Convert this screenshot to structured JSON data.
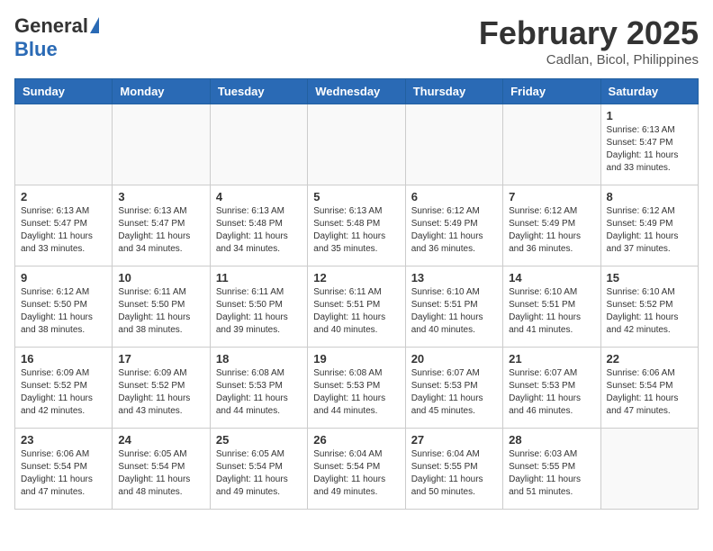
{
  "header": {
    "logo_general": "General",
    "logo_blue": "Blue",
    "month_title": "February 2025",
    "location": "Cadlan, Bicol, Philippines"
  },
  "weekdays": [
    "Sunday",
    "Monday",
    "Tuesday",
    "Wednesday",
    "Thursday",
    "Friday",
    "Saturday"
  ],
  "weeks": [
    [
      {
        "day": "",
        "info": ""
      },
      {
        "day": "",
        "info": ""
      },
      {
        "day": "",
        "info": ""
      },
      {
        "day": "",
        "info": ""
      },
      {
        "day": "",
        "info": ""
      },
      {
        "day": "",
        "info": ""
      },
      {
        "day": "1",
        "info": "Sunrise: 6:13 AM\nSunset: 5:47 PM\nDaylight: 11 hours\nand 33 minutes."
      }
    ],
    [
      {
        "day": "2",
        "info": "Sunrise: 6:13 AM\nSunset: 5:47 PM\nDaylight: 11 hours\nand 33 minutes."
      },
      {
        "day": "3",
        "info": "Sunrise: 6:13 AM\nSunset: 5:47 PM\nDaylight: 11 hours\nand 34 minutes."
      },
      {
        "day": "4",
        "info": "Sunrise: 6:13 AM\nSunset: 5:48 PM\nDaylight: 11 hours\nand 34 minutes."
      },
      {
        "day": "5",
        "info": "Sunrise: 6:13 AM\nSunset: 5:48 PM\nDaylight: 11 hours\nand 35 minutes."
      },
      {
        "day": "6",
        "info": "Sunrise: 6:12 AM\nSunset: 5:49 PM\nDaylight: 11 hours\nand 36 minutes."
      },
      {
        "day": "7",
        "info": "Sunrise: 6:12 AM\nSunset: 5:49 PM\nDaylight: 11 hours\nand 36 minutes."
      },
      {
        "day": "8",
        "info": "Sunrise: 6:12 AM\nSunset: 5:49 PM\nDaylight: 11 hours\nand 37 minutes."
      }
    ],
    [
      {
        "day": "9",
        "info": "Sunrise: 6:12 AM\nSunset: 5:50 PM\nDaylight: 11 hours\nand 38 minutes."
      },
      {
        "day": "10",
        "info": "Sunrise: 6:11 AM\nSunset: 5:50 PM\nDaylight: 11 hours\nand 38 minutes."
      },
      {
        "day": "11",
        "info": "Sunrise: 6:11 AM\nSunset: 5:50 PM\nDaylight: 11 hours\nand 39 minutes."
      },
      {
        "day": "12",
        "info": "Sunrise: 6:11 AM\nSunset: 5:51 PM\nDaylight: 11 hours\nand 40 minutes."
      },
      {
        "day": "13",
        "info": "Sunrise: 6:10 AM\nSunset: 5:51 PM\nDaylight: 11 hours\nand 40 minutes."
      },
      {
        "day": "14",
        "info": "Sunrise: 6:10 AM\nSunset: 5:51 PM\nDaylight: 11 hours\nand 41 minutes."
      },
      {
        "day": "15",
        "info": "Sunrise: 6:10 AM\nSunset: 5:52 PM\nDaylight: 11 hours\nand 42 minutes."
      }
    ],
    [
      {
        "day": "16",
        "info": "Sunrise: 6:09 AM\nSunset: 5:52 PM\nDaylight: 11 hours\nand 42 minutes."
      },
      {
        "day": "17",
        "info": "Sunrise: 6:09 AM\nSunset: 5:52 PM\nDaylight: 11 hours\nand 43 minutes."
      },
      {
        "day": "18",
        "info": "Sunrise: 6:08 AM\nSunset: 5:53 PM\nDaylight: 11 hours\nand 44 minutes."
      },
      {
        "day": "19",
        "info": "Sunrise: 6:08 AM\nSunset: 5:53 PM\nDaylight: 11 hours\nand 44 minutes."
      },
      {
        "day": "20",
        "info": "Sunrise: 6:07 AM\nSunset: 5:53 PM\nDaylight: 11 hours\nand 45 minutes."
      },
      {
        "day": "21",
        "info": "Sunrise: 6:07 AM\nSunset: 5:53 PM\nDaylight: 11 hours\nand 46 minutes."
      },
      {
        "day": "22",
        "info": "Sunrise: 6:06 AM\nSunset: 5:54 PM\nDaylight: 11 hours\nand 47 minutes."
      }
    ],
    [
      {
        "day": "23",
        "info": "Sunrise: 6:06 AM\nSunset: 5:54 PM\nDaylight: 11 hours\nand 47 minutes."
      },
      {
        "day": "24",
        "info": "Sunrise: 6:05 AM\nSunset: 5:54 PM\nDaylight: 11 hours\nand 48 minutes."
      },
      {
        "day": "25",
        "info": "Sunrise: 6:05 AM\nSunset: 5:54 PM\nDaylight: 11 hours\nand 49 minutes."
      },
      {
        "day": "26",
        "info": "Sunrise: 6:04 AM\nSunset: 5:54 PM\nDaylight: 11 hours\nand 49 minutes."
      },
      {
        "day": "27",
        "info": "Sunrise: 6:04 AM\nSunset: 5:55 PM\nDaylight: 11 hours\nand 50 minutes."
      },
      {
        "day": "28",
        "info": "Sunrise: 6:03 AM\nSunset: 5:55 PM\nDaylight: 11 hours\nand 51 minutes."
      },
      {
        "day": "",
        "info": ""
      }
    ]
  ]
}
